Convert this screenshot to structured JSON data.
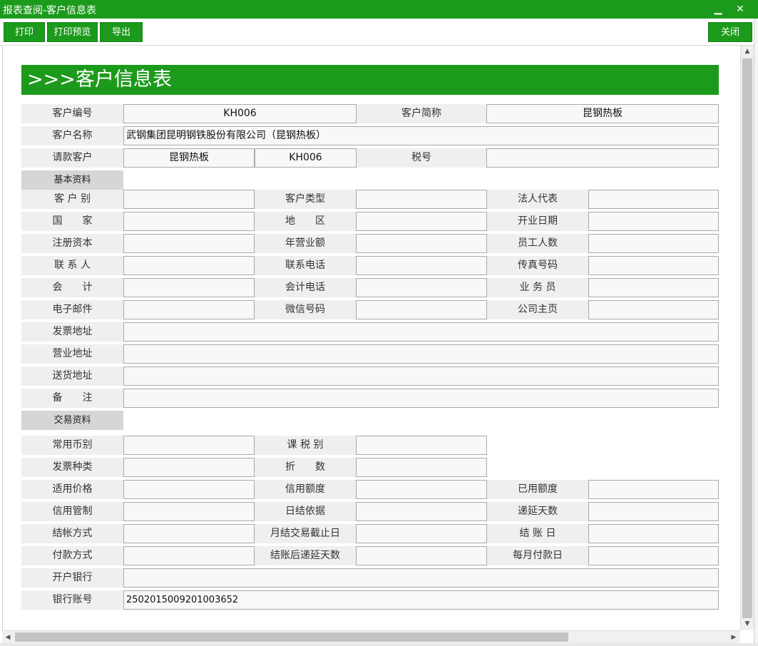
{
  "window": {
    "title": "报表查阅-客户信息表",
    "minimize_icon": "minimize-icon",
    "close_icon": "close-icon"
  },
  "toolbar": {
    "print": "打印",
    "preview": "打印预览",
    "export": "导出",
    "close": "关闭"
  },
  "banner": ">>>客户信息表",
  "header": {
    "code_label": "客户编号",
    "code_value": "KH006",
    "short_label": "客户简称",
    "short_value": "昆钢热板",
    "name_label": "客户名称",
    "name_value": "武钢集团昆明钢铁股份有限公司（昆钢热板）",
    "bill_label": "请款客户",
    "bill_value1": "昆钢热板",
    "bill_value2": "KH006",
    "tax_label": "税号",
    "tax_value": ""
  },
  "basic": {
    "section": "基本资料",
    "customer_class": "客 户 别",
    "customer_type": "客户类型",
    "legal_rep": "法人代表",
    "country": "国　　家",
    "region": "地　　区",
    "open_date": "开业日期",
    "reg_capital": "注册资本",
    "annual_revenue": "年营业额",
    "employee_count": "员工人数",
    "contact": "联 系 人",
    "contact_phone": "联系电话",
    "fax": "传真号码",
    "accountant": "会　　计",
    "accountant_phone": "会计电话",
    "salesperson": "业 务 员",
    "email": "电子邮件",
    "wechat": "微信号码",
    "homepage": "公司主页",
    "invoice_address": "发票地址",
    "business_address": "营业地址",
    "delivery_address": "送货地址",
    "remarks": "备　　注"
  },
  "trade": {
    "section": "交易资料",
    "currency": "常用币别",
    "tax_class": "课 税 别",
    "invoice_type": "发票种类",
    "discount": "折　　数",
    "price_applied": "适用价格",
    "credit_limit": "信用额度",
    "used_limit": "已用额度",
    "credit_control": "信用管制",
    "settle_basis": "日结依据",
    "deferred_days": "递延天数",
    "settle_method": "结帐方式",
    "monthly_cutoff": "月结交易截止日",
    "settle_day": "结 账 日",
    "payment_method": "付款方式",
    "post_settle_days": "结账后递延天数",
    "monthly_pay_day": "每月付款日",
    "bank": "开户银行",
    "bank_account": "银行账号",
    "bank_account_value": "2502015009201003652"
  }
}
